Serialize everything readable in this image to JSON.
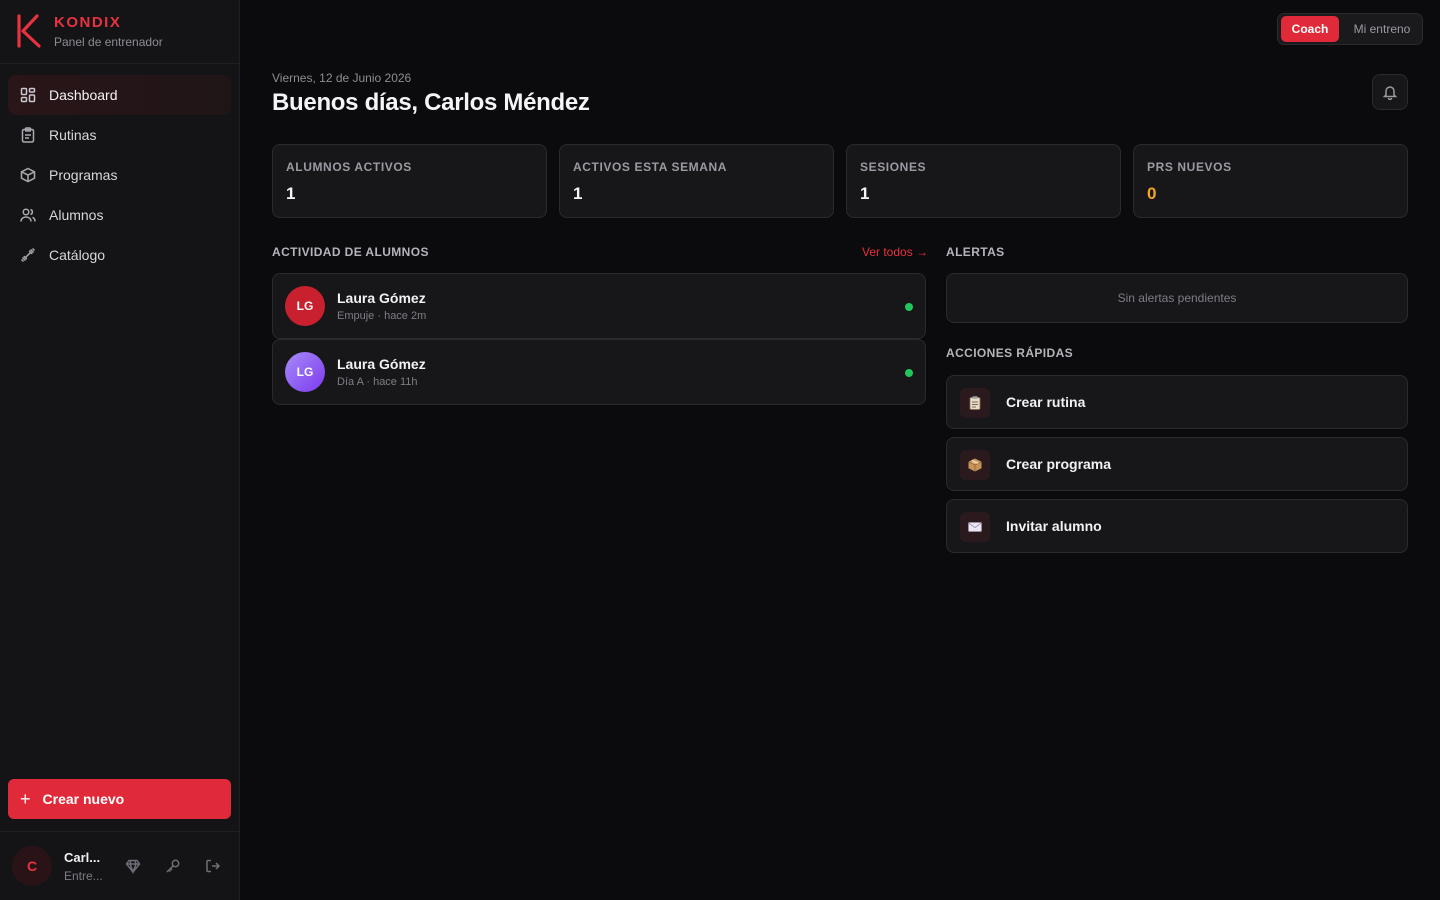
{
  "brand": {
    "name": "KONDIX",
    "subtitle": "Panel de entrenador",
    "color": "#e8323f"
  },
  "sidebar": {
    "items": [
      {
        "label": "Dashboard",
        "icon": "grid-icon",
        "active": true
      },
      {
        "label": "Rutinas",
        "icon": "clipboard-icon",
        "active": false
      },
      {
        "label": "Programas",
        "icon": "package-icon",
        "active": false
      },
      {
        "label": "Alumnos",
        "icon": "users-icon",
        "active": false
      },
      {
        "label": "Catálogo",
        "icon": "dumbbell-icon",
        "active": false
      }
    ],
    "create_label": "Crear nuevo",
    "user": {
      "initial": "C",
      "name": "Carl...",
      "role": "Entre..."
    }
  },
  "mode_toggle": {
    "coach": "Coach",
    "mine": "Mi entreno",
    "selected": "Coach"
  },
  "header": {
    "date": "Viernes, 12 de Junio 2026",
    "greeting": "Buenos días, Carlos Méndez"
  },
  "stats": [
    {
      "label": "ALUMNOS ACTIVOS",
      "value": "1",
      "color": "#f5f5f7"
    },
    {
      "label": "ACTIVOS ESTA SEMANA",
      "value": "1",
      "color": "#f5f5f7"
    },
    {
      "label": "SESIONES",
      "value": "1",
      "color": "#f5f5f7"
    },
    {
      "label": "PRS NUEVOS",
      "value": "0",
      "color": "#f5a524"
    }
  ],
  "activity": {
    "title": "ACTIVIDAD DE ALUMNOS",
    "see_all": "Ver todos →",
    "items": [
      {
        "initials": "LG",
        "name": "Laura Gómez",
        "sub": "Empuje · hace 2m",
        "avatar_color": "#c8202f",
        "status_color": "#22c55e"
      },
      {
        "initials": "LG",
        "name": "Laura Gómez",
        "sub": "Día A · hace 11h",
        "avatar_color": "#8b5cf6",
        "status_color": "#22c55e"
      }
    ]
  },
  "alerts": {
    "title": "ALERTAS",
    "empty": "Sin alertas pendientes"
  },
  "quick_actions": {
    "title": "ACCIONES RÁPIDAS",
    "items": [
      {
        "label": "Crear rutina",
        "icon": "clipboard-emoji-icon"
      },
      {
        "label": "Crear programa",
        "icon": "package-emoji-icon"
      },
      {
        "label": "Invitar alumno",
        "icon": "envelope-emoji-icon"
      }
    ]
  }
}
